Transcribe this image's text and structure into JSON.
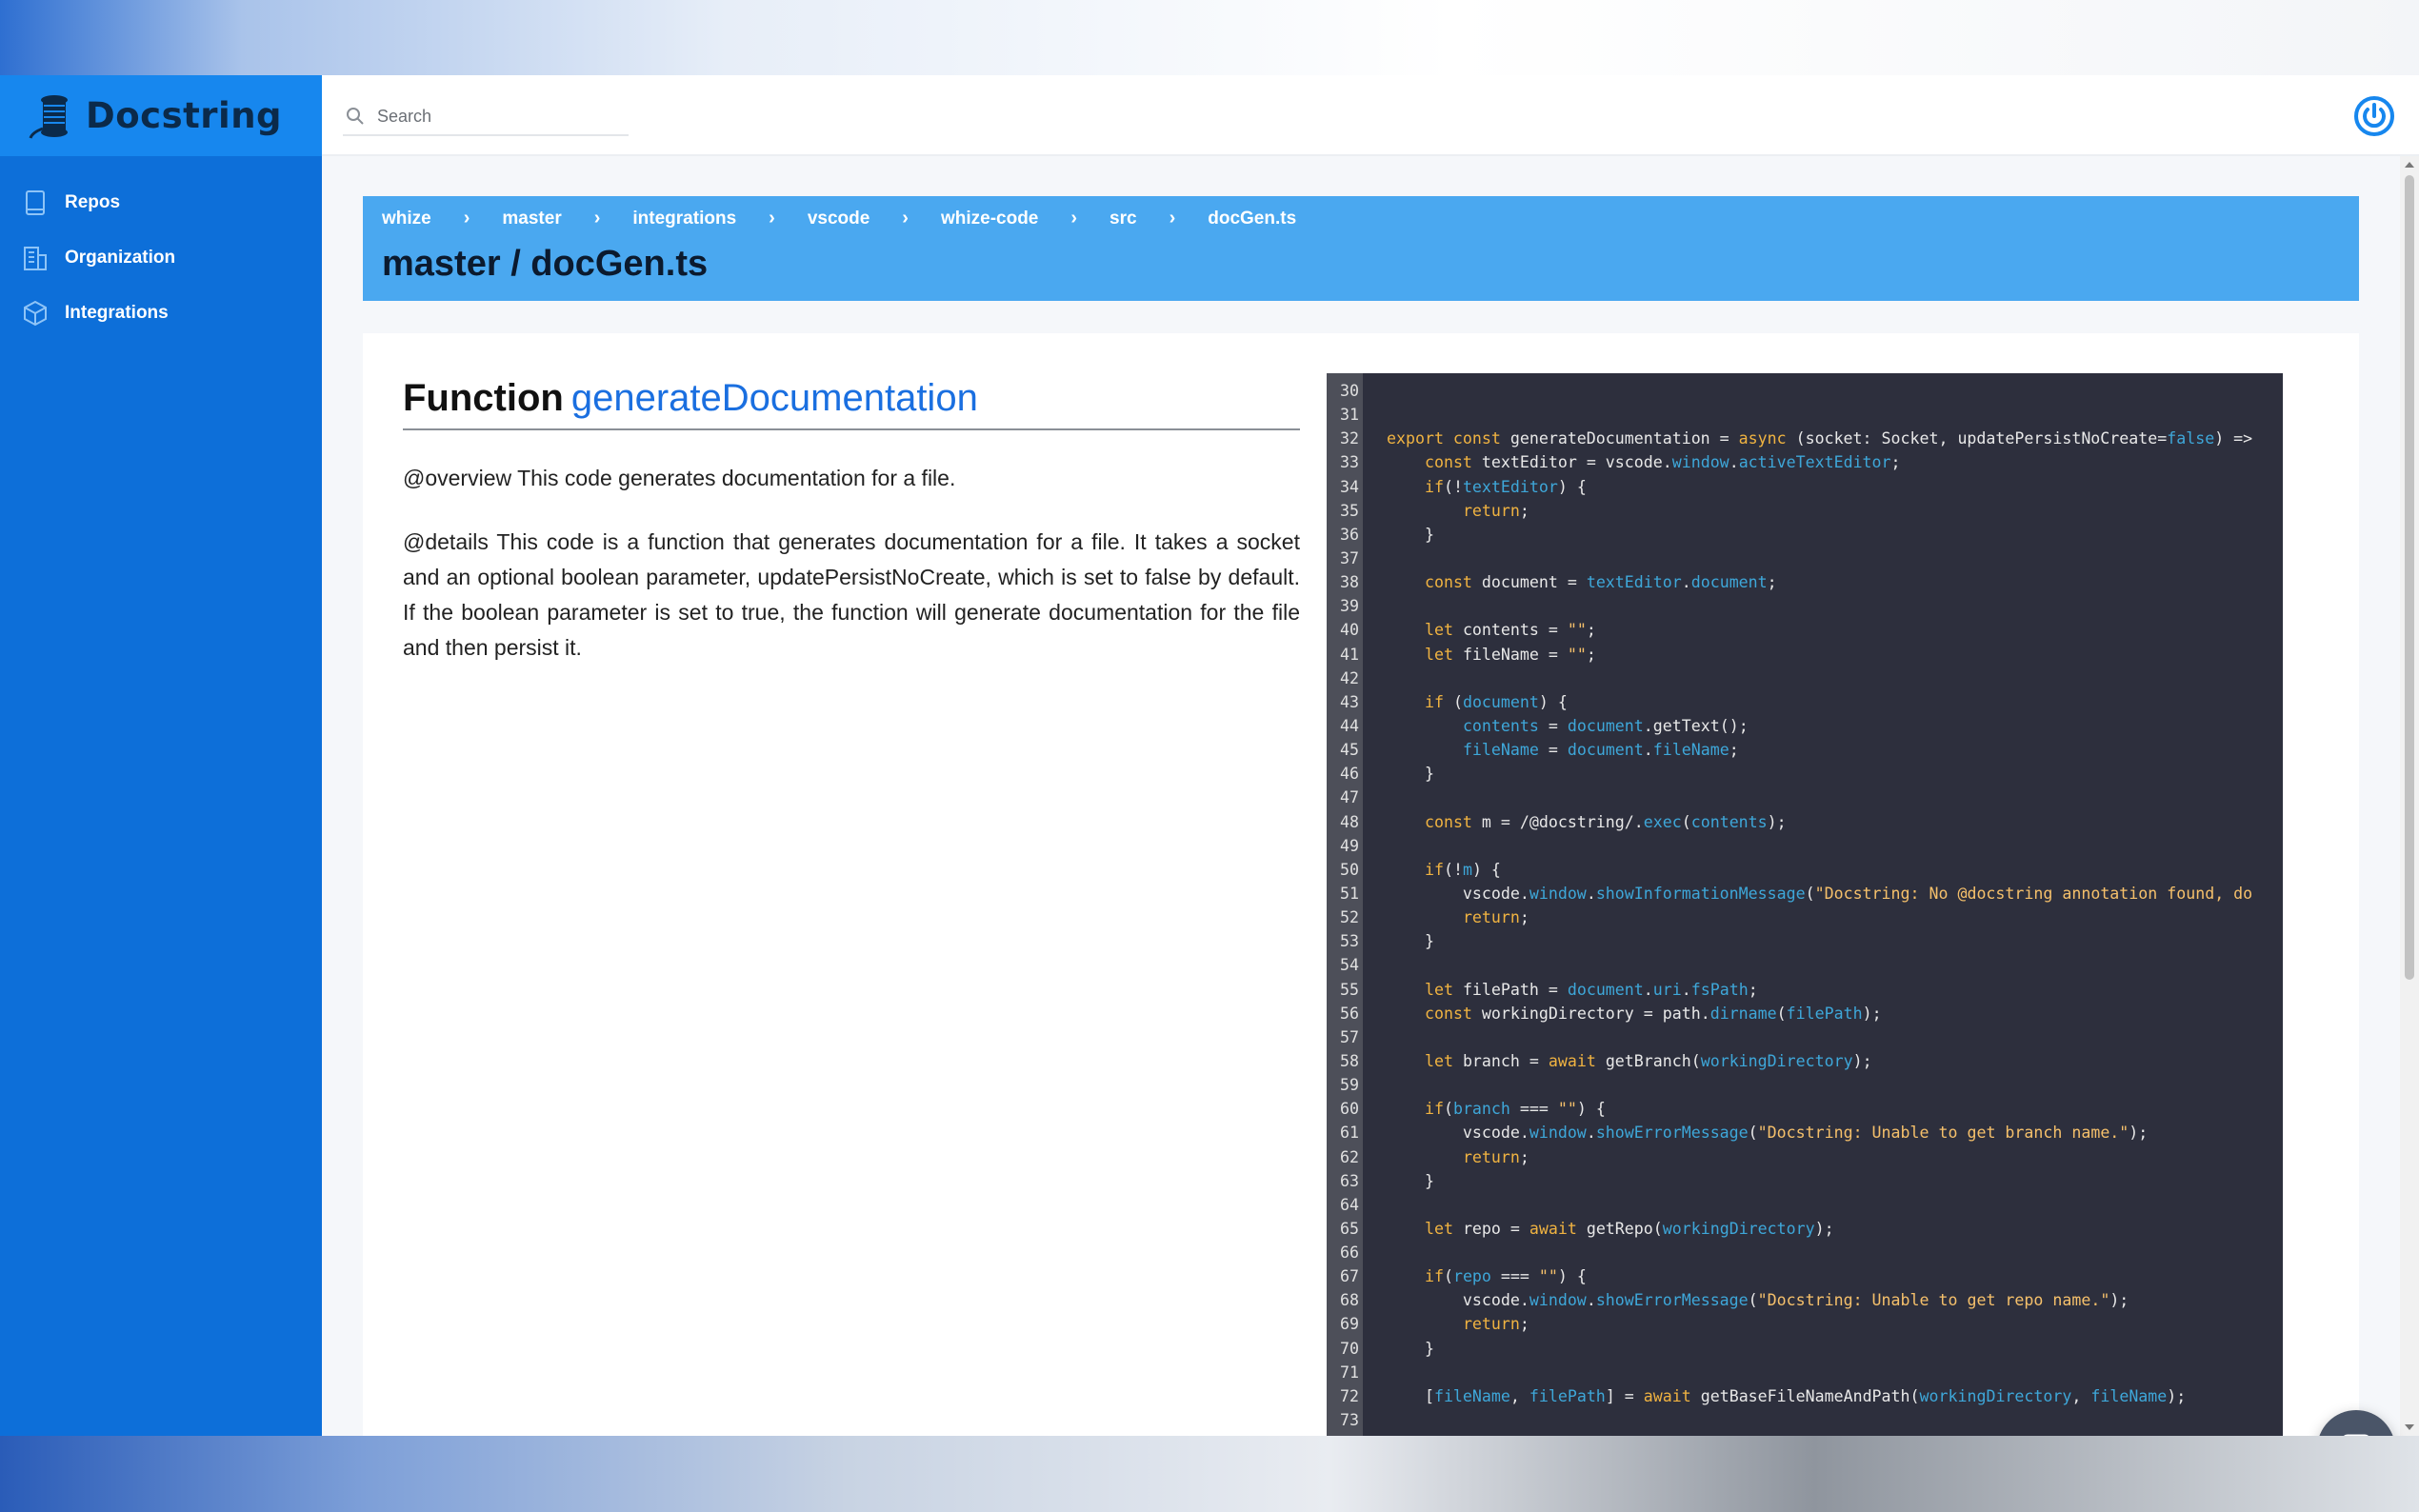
{
  "app": {
    "brand_name": "Docstring"
  },
  "sidebar": {
    "items": [
      {
        "label": "Repos",
        "icon": "book-icon"
      },
      {
        "label": "Organization",
        "icon": "building-icon"
      },
      {
        "label": "Integrations",
        "icon": "cube-icon"
      }
    ]
  },
  "topbar": {
    "search_placeholder": "Search",
    "power_icon": "power-icon"
  },
  "header": {
    "breadcrumbs": [
      "whize",
      "master",
      "integrations",
      "vscode",
      "whize-code",
      "src",
      "docGen.ts"
    ],
    "separator": "›",
    "title": "master / docGen.ts"
  },
  "doc": {
    "kind": "Function",
    "name": "generateDocumentation",
    "overview": "@overview This code generates documentation for a file.",
    "details": "@details This code is a function that generates documentation for a file. It takes a socket and an optional boolean parameter, updatePersistNoCreate, which is set to false by default. If the boolean parameter is set to true, the function will generate documentation for the file and then persist it."
  },
  "code": {
    "lines": [
      {
        "n": "30",
        "t": []
      },
      {
        "n": "31",
        "t": []
      },
      {
        "n": "32",
        "t": [
          [
            "kw",
            "export const "
          ],
          [
            "p",
            "generateDocumentation = "
          ],
          [
            "kw",
            "async "
          ],
          [
            "p",
            "(socket: Socket, updatePersistNoCreate="
          ],
          [
            "var",
            "false"
          ],
          [
            "p",
            ") =>"
          ]
        ]
      },
      {
        "n": "33",
        "t": [
          [
            "p",
            "    "
          ],
          [
            "kw",
            "const "
          ],
          [
            "p",
            "textEditor = vscode."
          ],
          [
            "var",
            "window"
          ],
          [
            "p",
            "."
          ],
          [
            "var",
            "activeTextEditor"
          ],
          [
            "p",
            ";"
          ]
        ]
      },
      {
        "n": "34",
        "t": [
          [
            "p",
            "    "
          ],
          [
            "kw",
            "if"
          ],
          [
            "p",
            "(!"
          ],
          [
            "var",
            "textEditor"
          ],
          [
            "p",
            ") {"
          ]
        ]
      },
      {
        "n": "35",
        "t": [
          [
            "p",
            "        "
          ],
          [
            "kw",
            "return"
          ],
          [
            "p",
            ";"
          ]
        ]
      },
      {
        "n": "36",
        "t": [
          [
            "p",
            "    }"
          ]
        ]
      },
      {
        "n": "37",
        "t": []
      },
      {
        "n": "38",
        "t": [
          [
            "p",
            "    "
          ],
          [
            "kw",
            "const "
          ],
          [
            "p",
            "document = "
          ],
          [
            "var",
            "textEditor"
          ],
          [
            "p",
            "."
          ],
          [
            "var",
            "document"
          ],
          [
            "p",
            ";"
          ]
        ]
      },
      {
        "n": "39",
        "t": []
      },
      {
        "n": "40",
        "t": [
          [
            "p",
            "    "
          ],
          [
            "kw",
            "let "
          ],
          [
            "p",
            "contents = "
          ],
          [
            "str",
            "\"\""
          ],
          [
            "p",
            ";"
          ]
        ]
      },
      {
        "n": "41",
        "t": [
          [
            "p",
            "    "
          ],
          [
            "kw",
            "let "
          ],
          [
            "p",
            "fileName = "
          ],
          [
            "str",
            "\"\""
          ],
          [
            "p",
            ";"
          ]
        ]
      },
      {
        "n": "42",
        "t": []
      },
      {
        "n": "43",
        "t": [
          [
            "p",
            "    "
          ],
          [
            "kw",
            "if "
          ],
          [
            "p",
            "("
          ],
          [
            "var",
            "document"
          ],
          [
            "p",
            ") {"
          ]
        ]
      },
      {
        "n": "44",
        "t": [
          [
            "p",
            "        "
          ],
          [
            "var",
            "contents"
          ],
          [
            "p",
            " = "
          ],
          [
            "var",
            "document"
          ],
          [
            "p",
            ".getText();"
          ]
        ]
      },
      {
        "n": "45",
        "t": [
          [
            "p",
            "        "
          ],
          [
            "var",
            "fileName"
          ],
          [
            "p",
            " = "
          ],
          [
            "var",
            "document"
          ],
          [
            "p",
            "."
          ],
          [
            "var",
            "fileName"
          ],
          [
            "p",
            ";"
          ]
        ]
      },
      {
        "n": "46",
        "t": [
          [
            "p",
            "    }"
          ]
        ]
      },
      {
        "n": "47",
        "t": []
      },
      {
        "n": "48",
        "t": [
          [
            "p",
            "    "
          ],
          [
            "kw",
            "const "
          ],
          [
            "p",
            "m = /@docstring/."
          ],
          [
            "var",
            "exec"
          ],
          [
            "p",
            "("
          ],
          [
            "var",
            "contents"
          ],
          [
            "p",
            ");"
          ]
        ]
      },
      {
        "n": "49",
        "t": []
      },
      {
        "n": "50",
        "t": [
          [
            "p",
            "    "
          ],
          [
            "kw",
            "if"
          ],
          [
            "p",
            "(!"
          ],
          [
            "var",
            "m"
          ],
          [
            "p",
            ") {"
          ]
        ]
      },
      {
        "n": "51",
        "t": [
          [
            "p",
            "        vscode."
          ],
          [
            "var",
            "window"
          ],
          [
            "p",
            "."
          ],
          [
            "var",
            "showInformationMessage"
          ],
          [
            "p",
            "("
          ],
          [
            "str",
            "\"Docstring: No @docstring annotation found, do"
          ]
        ]
      },
      {
        "n": "52",
        "t": [
          [
            "p",
            "        "
          ],
          [
            "kw",
            "return"
          ],
          [
            "p",
            ";"
          ]
        ]
      },
      {
        "n": "53",
        "t": [
          [
            "p",
            "    }"
          ]
        ]
      },
      {
        "n": "54",
        "t": []
      },
      {
        "n": "55",
        "t": [
          [
            "p",
            "    "
          ],
          [
            "kw",
            "let "
          ],
          [
            "p",
            "filePath = "
          ],
          [
            "var",
            "document"
          ],
          [
            "p",
            "."
          ],
          [
            "var",
            "uri"
          ],
          [
            "p",
            "."
          ],
          [
            "var",
            "fsPath"
          ],
          [
            "p",
            ";"
          ]
        ]
      },
      {
        "n": "56",
        "t": [
          [
            "p",
            "    "
          ],
          [
            "kw",
            "const "
          ],
          [
            "p",
            "workingDirectory = path."
          ],
          [
            "var",
            "dirname"
          ],
          [
            "p",
            "("
          ],
          [
            "var",
            "filePath"
          ],
          [
            "p",
            ");"
          ]
        ]
      },
      {
        "n": "57",
        "t": []
      },
      {
        "n": "58",
        "t": [
          [
            "p",
            "    "
          ],
          [
            "kw",
            "let "
          ],
          [
            "p",
            "branch = "
          ],
          [
            "kw",
            "await "
          ],
          [
            "p",
            "getBranch("
          ],
          [
            "var",
            "workingDirectory"
          ],
          [
            "p",
            ");"
          ]
        ]
      },
      {
        "n": "59",
        "t": []
      },
      {
        "n": "60",
        "t": [
          [
            "p",
            "    "
          ],
          [
            "kw",
            "if"
          ],
          [
            "p",
            "("
          ],
          [
            "var",
            "branch"
          ],
          [
            "p",
            " === "
          ],
          [
            "str",
            "\"\""
          ],
          [
            "p",
            ") {"
          ]
        ]
      },
      {
        "n": "61",
        "t": [
          [
            "p",
            "        vscode."
          ],
          [
            "var",
            "window"
          ],
          [
            "p",
            "."
          ],
          [
            "var",
            "showErrorMessage"
          ],
          [
            "p",
            "("
          ],
          [
            "str",
            "\"Docstring: Unable to get branch name.\""
          ],
          [
            "p",
            ");"
          ]
        ]
      },
      {
        "n": "62",
        "t": [
          [
            "p",
            "        "
          ],
          [
            "kw",
            "return"
          ],
          [
            "p",
            ";"
          ]
        ]
      },
      {
        "n": "63",
        "t": [
          [
            "p",
            "    }"
          ]
        ]
      },
      {
        "n": "64",
        "t": []
      },
      {
        "n": "65",
        "t": [
          [
            "p",
            "    "
          ],
          [
            "kw",
            "let "
          ],
          [
            "p",
            "repo = "
          ],
          [
            "kw",
            "await "
          ],
          [
            "p",
            "getRepo("
          ],
          [
            "var",
            "workingDirectory"
          ],
          [
            "p",
            ");"
          ]
        ]
      },
      {
        "n": "66",
        "t": []
      },
      {
        "n": "67",
        "t": [
          [
            "p",
            "    "
          ],
          [
            "kw",
            "if"
          ],
          [
            "p",
            "("
          ],
          [
            "var",
            "repo"
          ],
          [
            "p",
            " === "
          ],
          [
            "str",
            "\"\""
          ],
          [
            "p",
            ") {"
          ]
        ]
      },
      {
        "n": "68",
        "t": [
          [
            "p",
            "        vscode."
          ],
          [
            "var",
            "window"
          ],
          [
            "p",
            "."
          ],
          [
            "var",
            "showErrorMessage"
          ],
          [
            "p",
            "("
          ],
          [
            "str",
            "\"Docstring: Unable to get repo name.\""
          ],
          [
            "p",
            ");"
          ]
        ]
      },
      {
        "n": "69",
        "t": [
          [
            "p",
            "        "
          ],
          [
            "kw",
            "return"
          ],
          [
            "p",
            ";"
          ]
        ]
      },
      {
        "n": "70",
        "t": [
          [
            "p",
            "    }"
          ]
        ]
      },
      {
        "n": "71",
        "t": []
      },
      {
        "n": "72",
        "t": [
          [
            "p",
            "    ["
          ],
          [
            "var",
            "fileName"
          ],
          [
            "p",
            ", "
          ],
          [
            "var",
            "filePath"
          ],
          [
            "p",
            "] = "
          ],
          [
            "kw",
            "await "
          ],
          [
            "p",
            "getBaseFileNameAndPath("
          ],
          [
            "var",
            "workingDirectory"
          ],
          [
            "p",
            ", "
          ],
          [
            "var",
            "fileName"
          ],
          [
            "p",
            ");"
          ]
        ]
      },
      {
        "n": "73",
        "t": []
      }
    ]
  },
  "colors": {
    "sidebar": "#0d6fd9",
    "brand_bar": "#1787ee",
    "header_card": "#4aa8f0",
    "link": "#1a6fe0",
    "code_bg": "#2d2f3d",
    "code_keyword": "#f0b341",
    "code_variable": "#3ea7d9"
  },
  "chat": {
    "icon": "chat-icon"
  }
}
